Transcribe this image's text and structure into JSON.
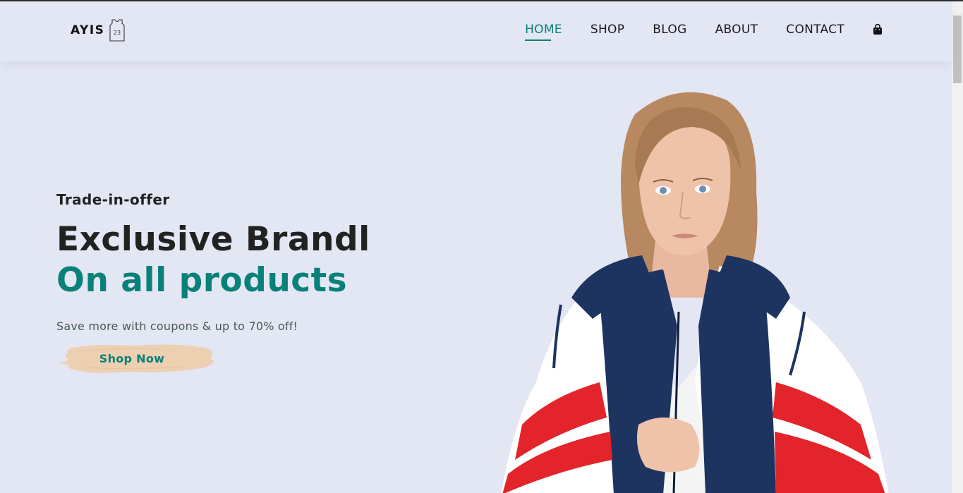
{
  "brand": {
    "logo_text": "AYIS",
    "jersey_number": "23"
  },
  "nav": {
    "items": [
      {
        "label": "HOME",
        "active": true
      },
      {
        "label": "SHOP",
        "active": false
      },
      {
        "label": "BLOG",
        "active": false
      },
      {
        "label": "ABOUT",
        "active": false
      },
      {
        "label": "CONTACT",
        "active": false
      }
    ],
    "cart_icon": "shopping-bag-icon"
  },
  "hero": {
    "subtitle": "Trade-in-offer",
    "headline": "Exclusive Brandl",
    "headline_accent": "On all products",
    "description": "Save more with coupons & up to 70% off!",
    "cta_label": "Shop Now"
  },
  "colors": {
    "background": "#E3E6F3",
    "accent": "#088178",
    "text": "#222222",
    "button_brush": "#EDCFB2"
  }
}
